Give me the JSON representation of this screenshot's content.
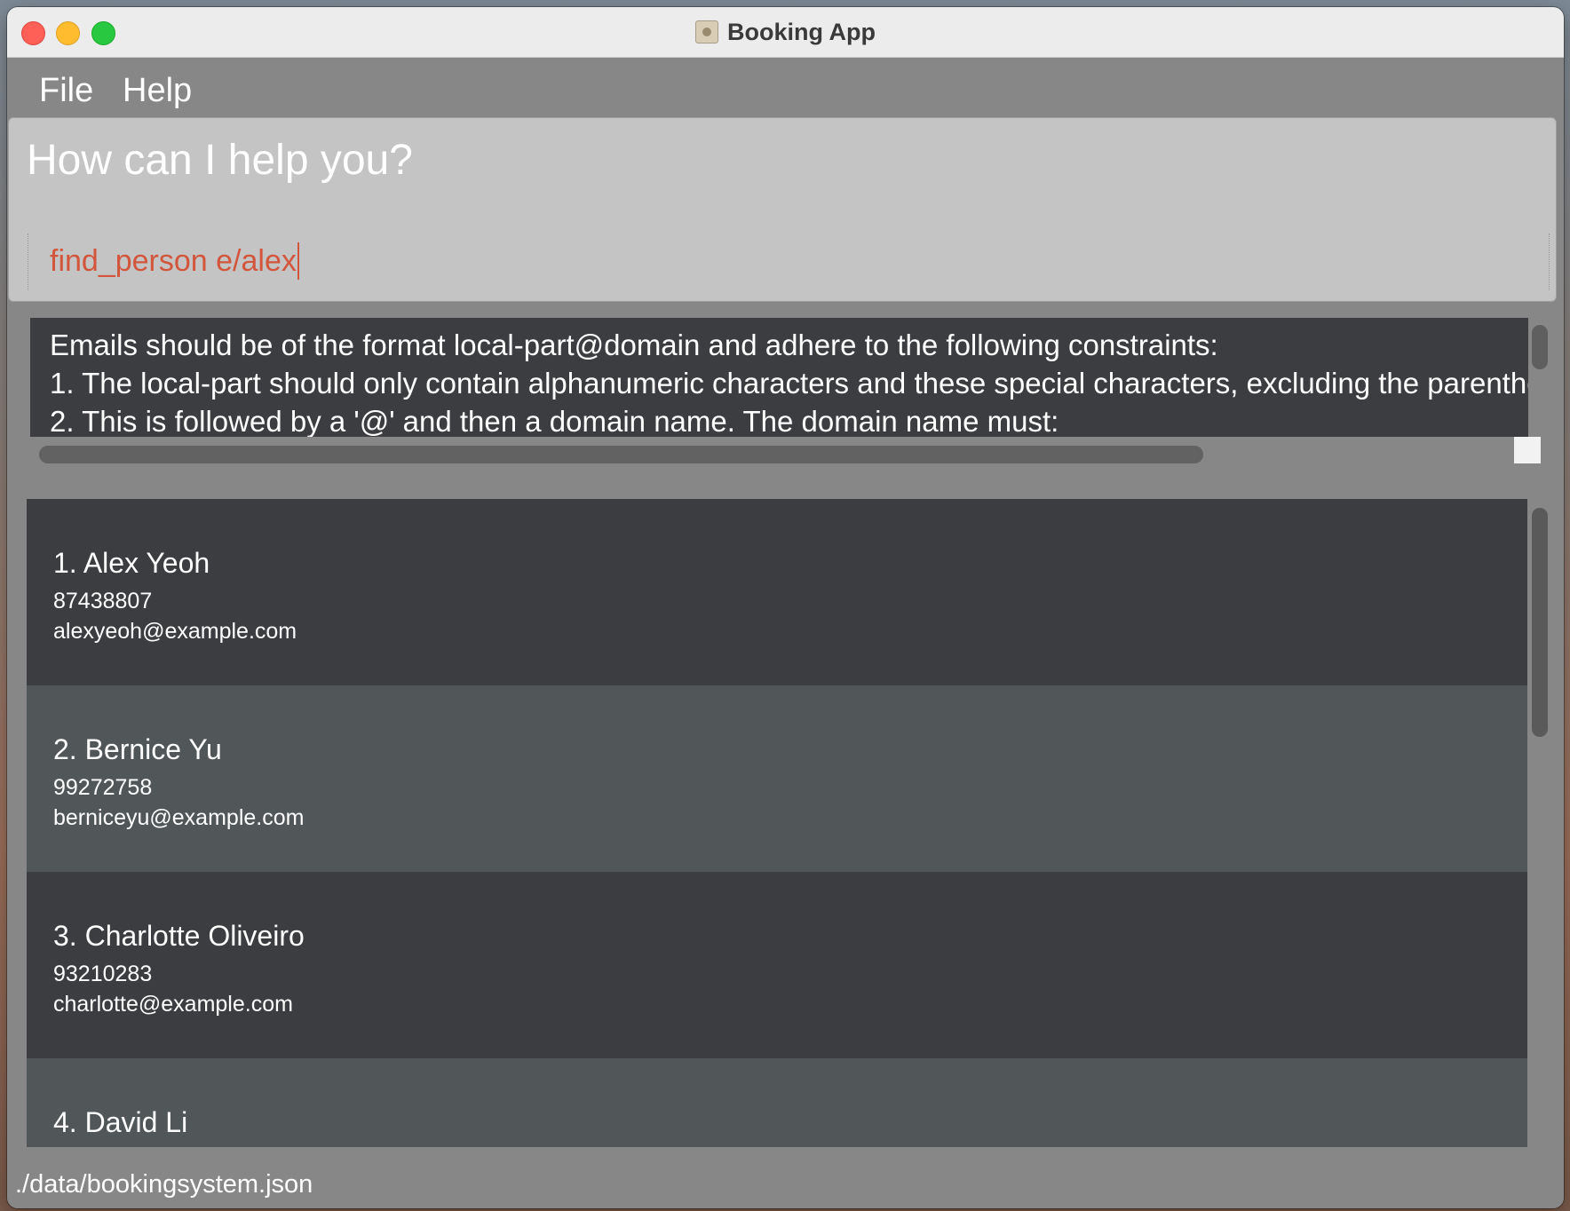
{
  "window": {
    "title": "Booking App"
  },
  "menu": {
    "file": "File",
    "help": "Help"
  },
  "command": {
    "prompt": "How can I help you?",
    "input_value": "find_person e/alex"
  },
  "result": {
    "lines": [
      "Emails should be of the format local-part@domain and adhere to the following constraints:",
      "1. The local-part should only contain alphanumeric characters and these special characters, excluding the parenthe",
      "2. This is followed by a '@' and then a domain name. The domain name must:"
    ]
  },
  "persons": [
    {
      "index": "1.",
      "name": "Alex Yeoh",
      "phone": "87438807",
      "email": "alexyeoh@example.com"
    },
    {
      "index": "2.",
      "name": "Bernice Yu",
      "phone": "99272758",
      "email": "berniceyu@example.com"
    },
    {
      "index": "3.",
      "name": "Charlotte Oliveiro",
      "phone": "93210283",
      "email": "charlotte@example.com"
    },
    {
      "index": "4.",
      "name": "David Li"
    }
  ],
  "status": {
    "path": "./data/bookingsystem.json"
  }
}
